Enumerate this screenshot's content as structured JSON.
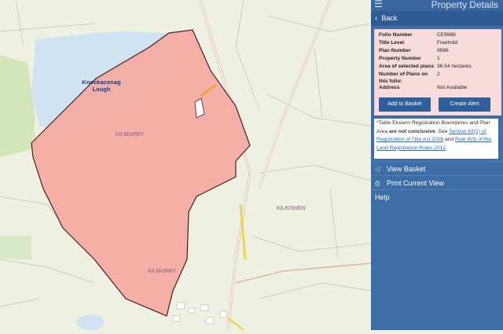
{
  "header": {
    "menu_icon": "menu-icon",
    "title": "Property Details"
  },
  "back": {
    "label": "Back",
    "icon": "chevron-left-icon"
  },
  "details": {
    "rows": [
      {
        "label": "Folio Number",
        "value": "CE9986"
      },
      {
        "label": "Title Level",
        "value": "Freehold"
      },
      {
        "label": "Plan Number",
        "value": "9986"
      },
      {
        "label": "Property Number",
        "value": "1"
      },
      {
        "label": "Area of selected plans",
        "value": "36.54 hectares."
      },
      {
        "label": "Number of Plans on this folio:",
        "value": "2"
      },
      {
        "label": "Address",
        "value": "Not Available"
      }
    ],
    "add_to_basket": "Add to Basket",
    "create_alert": "Create Alert"
  },
  "disclaimer": {
    "prefix": "*Tailte Éireann Registration Boundaries and Plan Area ",
    "bold": "are not conclusive",
    "middle": ". See ",
    "link1": "Section 62(2) of Registration of Title Act 2006",
    "and": " and ",
    "link2": "Rule 8(3) of the Land Registration Rules 2012",
    "suffix": "."
  },
  "nav": {
    "view_basket": "View Basket",
    "print_view": "Print Current View",
    "help": "Help"
  },
  "map": {
    "labels": {
      "lake": "Knockaconag Lough",
      "kilmurry_north": "KILMURRY",
      "kilmurry_south": "KILMURRY",
      "kilkishen": "KILKISHEN"
    },
    "colors": {
      "parcel_fill": "#f4a8a0",
      "lake_fill": "#cfe3f3",
      "panel": "#3d6ea6"
    }
  }
}
